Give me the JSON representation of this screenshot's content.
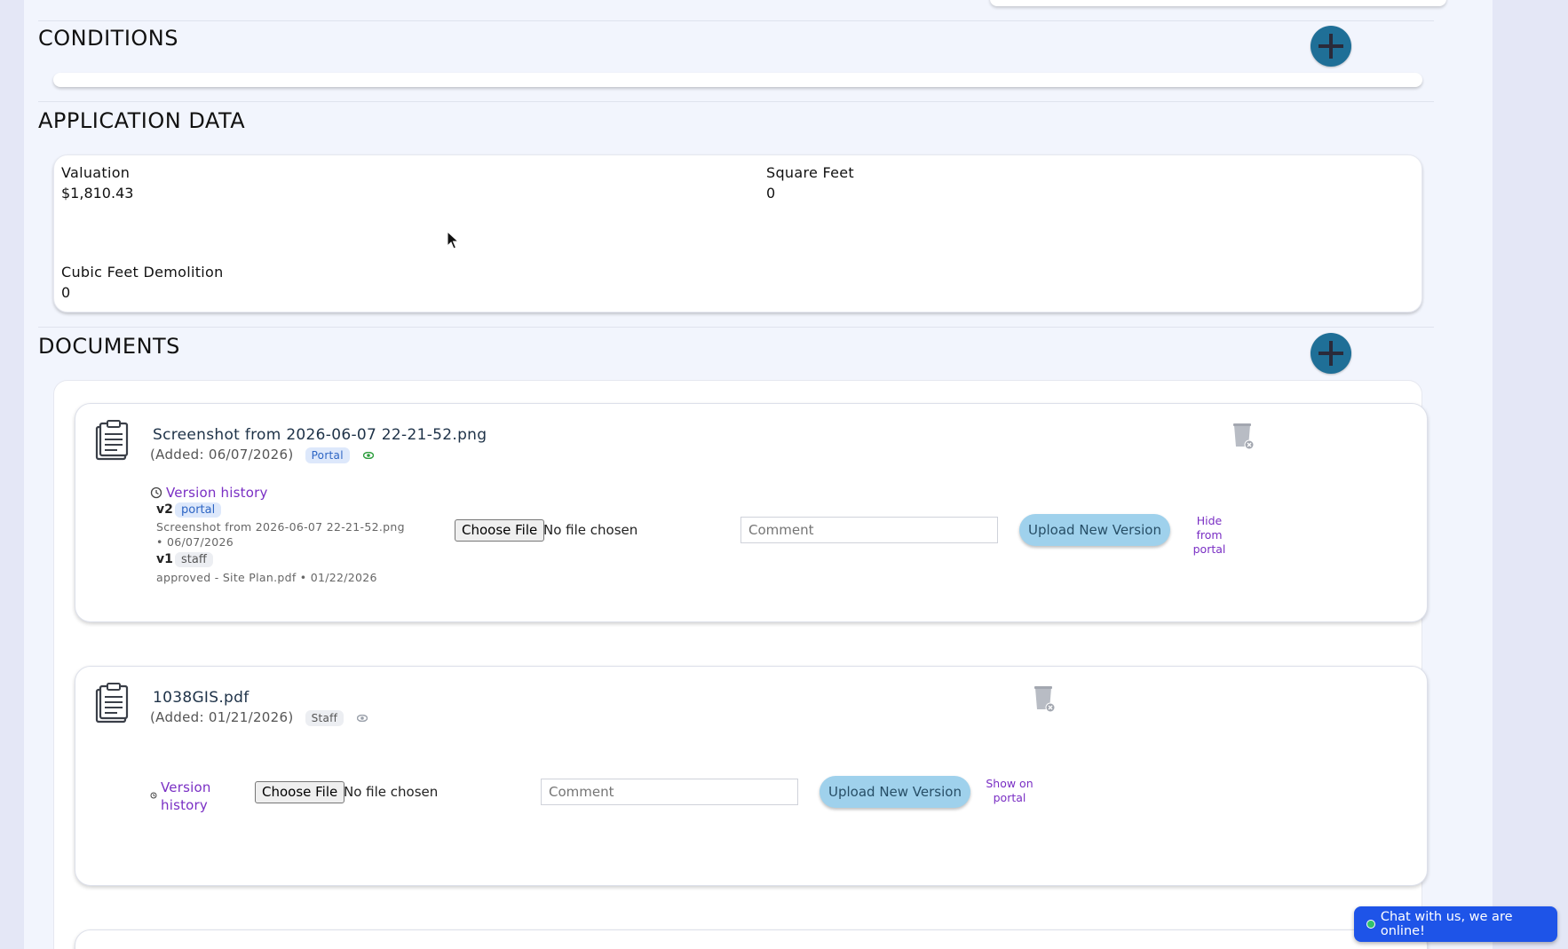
{
  "sections": {
    "conditions_title": "CONDITIONS",
    "application_data_title": "APPLICATION DATA",
    "documents_title": "DOCUMENTS"
  },
  "application_data": {
    "valuation_label": "Valuation",
    "valuation_value": "$1,810.43",
    "square_feet_label": "Square Feet",
    "square_feet_value": "0",
    "cubic_feet_label": "Cubic Feet Demolition",
    "cubic_feet_value": "0"
  },
  "documents": [
    {
      "name": "Screenshot from 2026-06-07 22-21-52.png",
      "added": "(Added: 06/07/2026)",
      "badge": "Portal",
      "version_history": "Version history",
      "versions": [
        {
          "label": "v2",
          "tag": "portal",
          "meta_line1": "Screenshot from 2026-06-07 22-21-52.png",
          "meta_line2": "• 06/07/2026"
        },
        {
          "label": "v1",
          "tag": "staff",
          "meta_line1": "approved - Site Plan.pdf • 01/22/2026"
        }
      ],
      "choose_file": "Choose File",
      "file_status": "No file chosen",
      "comment_placeholder": "Comment",
      "upload_label": "Upload New Version",
      "portal_toggle": "Hide from portal"
    },
    {
      "name": "1038GIS.pdf",
      "added": "(Added: 01/21/2026)",
      "badge": "Staff",
      "version_history_line1": "Version",
      "version_history_line2": "history",
      "choose_file": "Choose File",
      "file_status": "No file chosen",
      "comment_placeholder": "Comment",
      "upload_label": "Upload New Version",
      "portal_toggle": "Show on portal"
    }
  ],
  "chat": {
    "label": "Chat with us, we are online!"
  },
  "colors": {
    "accent_button": "#1f6f97",
    "link_purple": "#7a2fc4",
    "upload_button": "#9fd1ec",
    "chat_button": "#1e54e8"
  }
}
